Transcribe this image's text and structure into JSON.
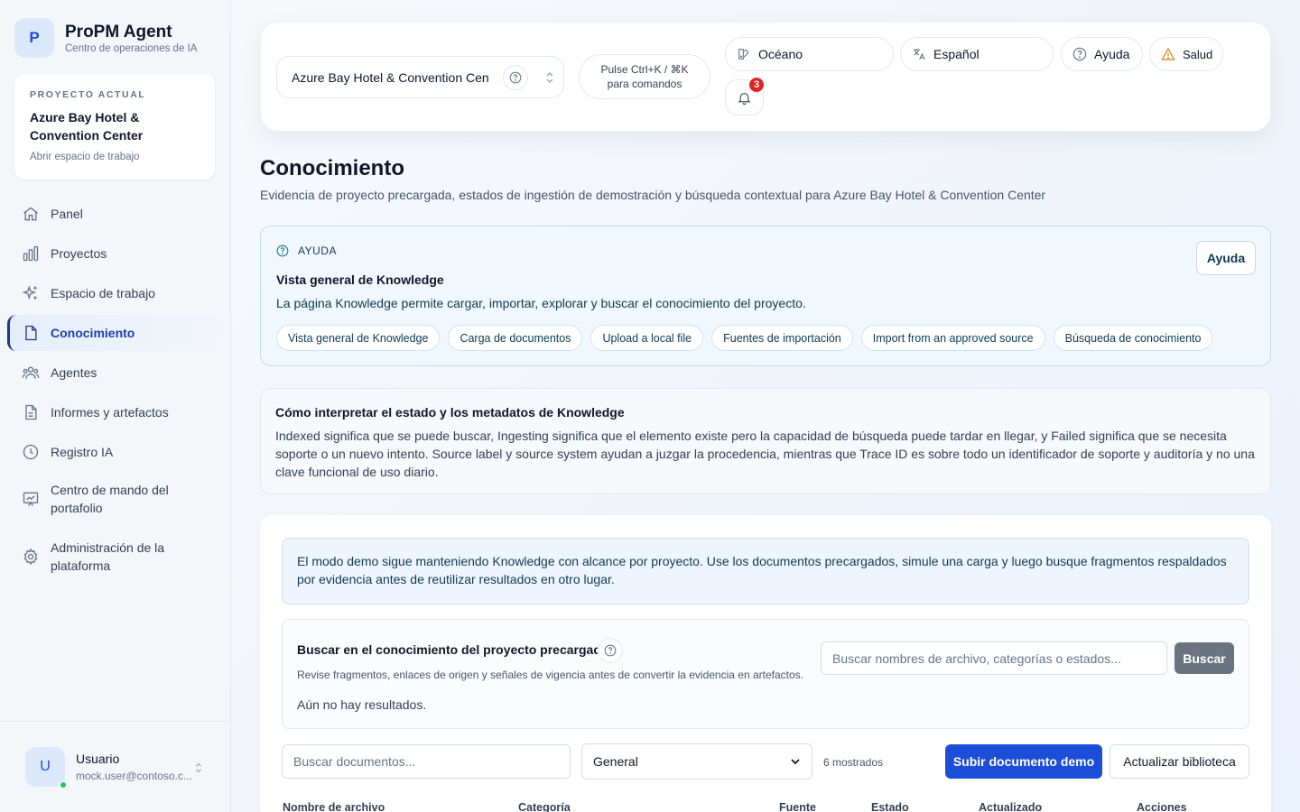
{
  "brand": {
    "logo_letter": "P",
    "title": "ProPM Agent",
    "subtitle": "Centro de operaciones de IA"
  },
  "current_project": {
    "kicker": "PROYECTO ACTUAL",
    "name": "Azure Bay Hotel & Convention Center",
    "open_link": "Abrir espacio de trabajo"
  },
  "nav": [
    {
      "label": "Panel",
      "icon": "home-icon"
    },
    {
      "label": "Proyectos",
      "icon": "bar-chart-icon"
    },
    {
      "label": "Espacio de trabajo",
      "icon": "sparkles-icon"
    },
    {
      "label": "Conocimiento",
      "icon": "document-icon",
      "active": true
    },
    {
      "label": "Agentes",
      "icon": "users-icon"
    },
    {
      "label": "Informes y artefactos",
      "icon": "file-text-icon"
    },
    {
      "label": "Registro IA",
      "icon": "clock-icon"
    },
    {
      "label": "Centro de mando del portafolio",
      "icon": "presentation-chart-icon"
    },
    {
      "label": "Administración de la plataforma",
      "icon": "gear-icon"
    }
  ],
  "user": {
    "initial": "U",
    "name": "Usuario",
    "email": "mock.user@contoso.c..."
  },
  "topbar": {
    "project_select": "Azure Bay Hotel & Convention Cen",
    "command_hint": "Pulse Ctrl+K / ⌘K para comandos",
    "theme_label": "Océano",
    "language_label": "Español",
    "help_label": "Ayuda",
    "health_label": "Salud",
    "notifications_count": "3"
  },
  "page": {
    "title": "Conocimiento",
    "subtitle": "Evidencia de proyecto precargada, estados de ingestión de demostración y búsqueda contextual para Azure Bay Hotel & Convention Center"
  },
  "help_panel": {
    "kicker": "AYUDA",
    "title": "Vista general de Knowledge",
    "description": "La página Knowledge permite cargar, importar, explorar y buscar el conocimiento del proyecto.",
    "button": "Ayuda",
    "chips": [
      "Vista general de Knowledge",
      "Carga de documentos",
      "Upload a local file",
      "Fuentes de importación",
      "Import from an approved source",
      "Búsqueda de conocimiento"
    ]
  },
  "interpretation": {
    "title": "Cómo interpretar el estado y los metadatos de Knowledge",
    "body": "Indexed significa que se puede buscar, Ingesting significa que el elemento existe pero la capacidad de búsqueda puede tardar en llegar, y Failed significa que se necesita soporte o un nuevo intento. Source label y source system ayudan a juzgar la procedencia, mientras que Trace ID es sobre todo un identificador de soporte y auditoría y no una clave funcional de uso diario."
  },
  "demo_note": "El modo demo sigue manteniendo Knowledge con alcance por proyecto. Use los documentos precargados, simule una carga y luego busque fragmentos respaldados por evidencia antes de reutilizar resultados en otro lugar.",
  "knowledge_search": {
    "title": "Buscar en el conocimiento del proyecto precargado",
    "description": "Revise fragmentos, enlaces de origen y señales de vigencia antes de convertir la evidencia en artefactos.",
    "empty": "Aún no hay resultados.",
    "placeholder": "Buscar nombres de archivo, categorías o estados...",
    "button": "Buscar"
  },
  "documents": {
    "search_placeholder": "Buscar documentos...",
    "category_selected": "General",
    "count_text": "6 mostrados",
    "upload_button": "Subir documento demo",
    "refresh_button": "Actualizar biblioteca",
    "columns": [
      "Nombre de archivo",
      "Categoría",
      "Fuente",
      "Estado",
      "Actualizado",
      "Acciones"
    ]
  }
}
